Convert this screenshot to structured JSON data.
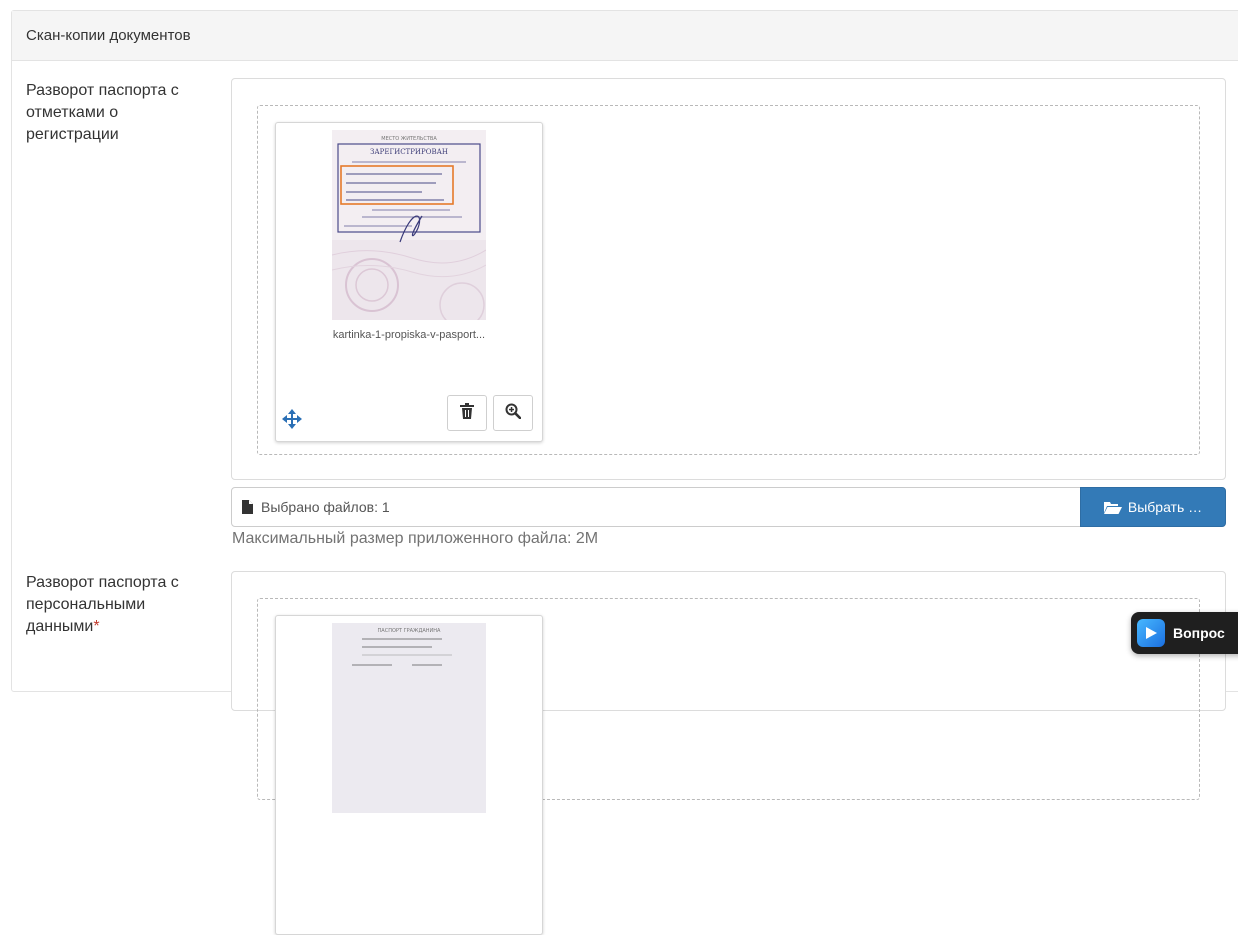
{
  "panel": {
    "heading": "Скан-копии документов"
  },
  "fields": [
    {
      "label": "Разворот паспорта с отметками о регистрации",
      "required": false,
      "file_name": "kartinka-1-propiska-v-pasport...",
      "selected_text": "Выбрано файлов: 1",
      "browse_label": "Выбрать …",
      "hint": "Максимальный размер приложенного файла: 2M"
    },
    {
      "label": "Разворот паспорта с персональными данными",
      "required": true,
      "required_mark": "*"
    }
  ],
  "icons": {
    "move": "arrows-move-icon",
    "delete": "trash-icon",
    "zoom": "zoom-in-icon",
    "file": "file-icon",
    "folder": "folder-open-icon"
  },
  "colors": {
    "primary": "#337ab7",
    "required": "#c0392b",
    "icon_blue": "#2a6fb5"
  },
  "chat_widget": {
    "label": "Вопрос"
  }
}
